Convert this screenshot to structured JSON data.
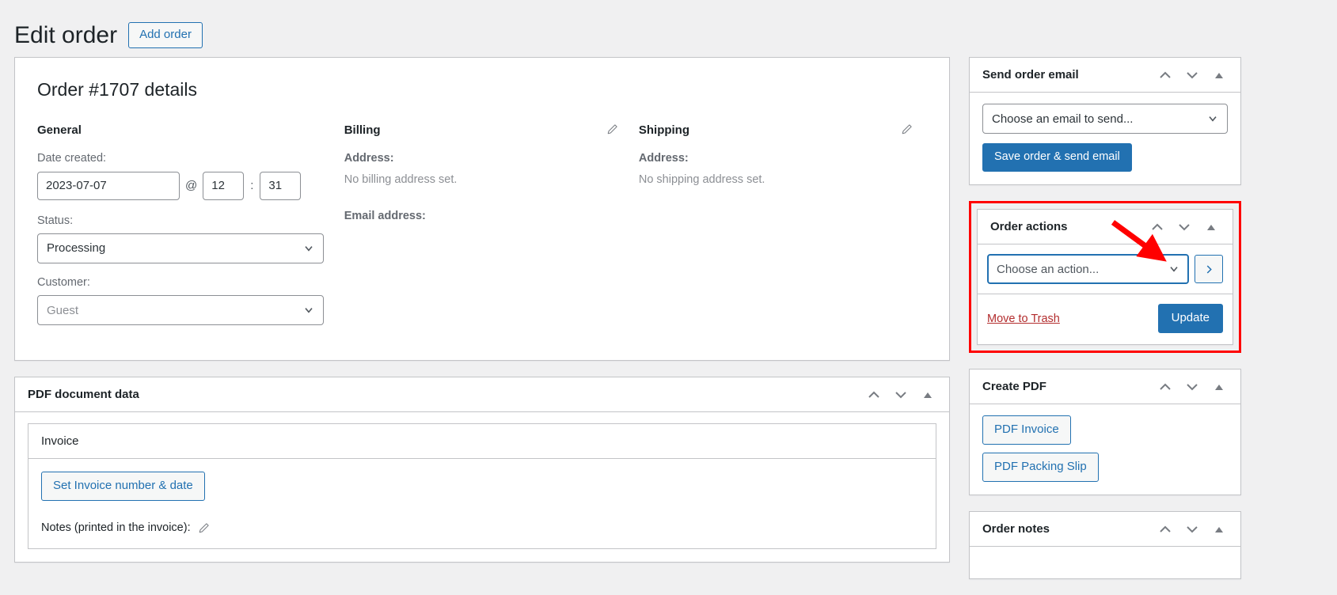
{
  "header": {
    "title": "Edit order",
    "add_order_label": "Add order"
  },
  "order_details": {
    "heading": "Order #1707 details",
    "general": {
      "title": "General",
      "date_label": "Date created:",
      "date_value": "2023-07-07",
      "at_symbol": "@",
      "hour_value": "12",
      "colon": ":",
      "minute_value": "31",
      "status_label": "Status:",
      "status_value": "Processing",
      "customer_label": "Customer:",
      "customer_value": "Guest"
    },
    "billing": {
      "title": "Billing",
      "address_label": "Address:",
      "address_value": "No billing address set.",
      "email_label": "Email address:",
      "email_value": ""
    },
    "shipping": {
      "title": "Shipping",
      "address_label": "Address:",
      "address_value": "No shipping address set."
    }
  },
  "pdf_document_data": {
    "title": "PDF document data",
    "document_name": "Invoice",
    "set_number_label": "Set Invoice number & date",
    "notes_label": "Notes (printed in the invoice):"
  },
  "sidebar": {
    "send_order_email": {
      "title": "Send order email",
      "select_value": "Choose an email to send...",
      "save_label": "Save order & send email"
    },
    "order_actions": {
      "title": "Order actions",
      "select_value": "Choose an action...",
      "go_label": "›",
      "trash_label": "Move to Trash",
      "update_label": "Update"
    },
    "create_pdf": {
      "title": "Create PDF",
      "buttons": [
        {
          "label": "PDF Invoice"
        },
        {
          "label": "PDF Packing Slip"
        }
      ]
    },
    "order_notes": {
      "title": "Order notes"
    }
  },
  "colors": {
    "accent": "#2271b1",
    "highlight": "#ff0000",
    "trash": "#b32d2e",
    "page_bg": "#f0f0f1",
    "border": "#c3c4c7"
  }
}
